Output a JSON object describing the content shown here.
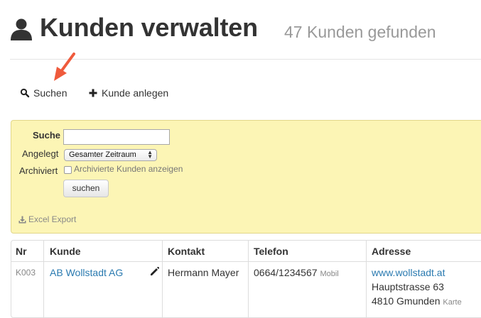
{
  "header": {
    "title": "Kunden verwalten",
    "subtitle": "47 Kunden gefunden",
    "icon": "user-icon"
  },
  "actions": {
    "search_label": "Suchen",
    "add_label": "Kunde anlegen"
  },
  "filter": {
    "search_label": "Suche",
    "search_value": "",
    "created_label": "Angelegt",
    "created_value": "Gesamter Zeitraum",
    "archived_label": "Archiviert",
    "archived_checkbox_label": "Archivierte Kunden anzeigen",
    "archived_checked": false,
    "submit_label": "suchen",
    "export_label": "Excel Export",
    "panel_color": "#fcf5b5"
  },
  "table": {
    "columns": [
      "Nr",
      "Kunde",
      "Kontakt",
      "Telefon",
      "Adresse"
    ],
    "rows": [
      {
        "nr": "K003",
        "kunde": "AB Wollstadt AG",
        "kontakt": "Hermann Mayer",
        "telefon": "0664/1234567",
        "telefon_type": "Mobil",
        "web": "www.wollstadt.at",
        "street": "Hauptstrasse 63",
        "city": "4810 Gmunden",
        "map_label": "Karte"
      }
    ]
  },
  "colors": {
    "link": "#2a7ab0",
    "arrow": "#ef5a3c",
    "muted": "#999999"
  }
}
